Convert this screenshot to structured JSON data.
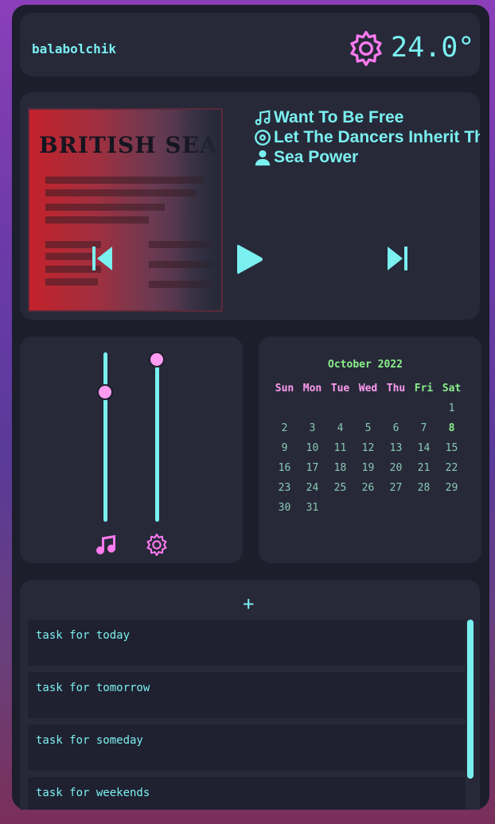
{
  "header": {
    "username": "balabolchik",
    "temperature": "24.0°",
    "weather_icon": "gear-icon"
  },
  "player": {
    "song": "Want To Be Free",
    "album": "Let The Dancers Inherit The Party",
    "artist": "Sea Power",
    "album_art_text": "BRITISH SEA POWER",
    "controls": [
      "previous",
      "play",
      "next"
    ]
  },
  "sliders": {
    "music_volume": 0.79,
    "system_volume": 1.0
  },
  "calendar": {
    "title": "October 2022",
    "weekdays": [
      "Sun",
      "Mon",
      "Tue",
      "Wed",
      "Thu",
      "Fri",
      "Sat"
    ],
    "weeks": [
      [
        "",
        "",
        "",
        "",
        "",
        "",
        "1"
      ],
      [
        "2",
        "3",
        "4",
        "5",
        "6",
        "7",
        "8"
      ],
      [
        "9",
        "10",
        "11",
        "12",
        "13",
        "14",
        "15"
      ],
      [
        "16",
        "17",
        "18",
        "19",
        "20",
        "21",
        "22"
      ],
      [
        "23",
        "24",
        "25",
        "26",
        "27",
        "28",
        "29"
      ],
      [
        "30",
        "31",
        "",
        "",
        "",
        "",
        ""
      ]
    ],
    "today": "8"
  },
  "todo": {
    "add_label": "+",
    "tasks": [
      "task for today",
      "task for tomorrow",
      "task for someday",
      "task for weekends"
    ]
  },
  "colors": {
    "accent_cyan": "#7af0f0",
    "accent_pink": "#ff9bf0",
    "accent_green": "#8af08a",
    "panel_bg": "#1d1e2c",
    "card_bg": "#272939"
  }
}
